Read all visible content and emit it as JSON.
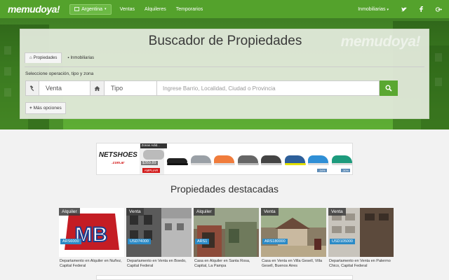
{
  "header": {
    "logo": "memudoya!",
    "country": "Argentina",
    "nav": [
      "Ventas",
      "Alquileres",
      "Temporarios"
    ],
    "inmobiliarias": "Inmobiliarias",
    "social": [
      "twitter-icon",
      "facebook-icon",
      "google-plus-icon"
    ]
  },
  "search": {
    "title": "Buscador de Propiedades",
    "watermark": "memudoya!",
    "tabs": [
      "Propiedades",
      "Inmobiliarias"
    ],
    "operation_label": "Seleccione operación, tipo y zona",
    "operation_value": "Venta",
    "type_value": "Tipo",
    "location_placeholder": "Ingrese Barrio, Localidad, Ciudad o Provincia",
    "more_options": "Más opciones"
  },
  "ad": {
    "brand": "NETSHOES",
    "brand_sub": ".com.ar",
    "promo_tag": "Zonas Adid...",
    "promo_price": "$359.89",
    "promo_cta": "AMPLIAR",
    "shoe_discounts": [
      "",
      "",
      "",
      "",
      "",
      "",
      "-34%",
      "-30%"
    ]
  },
  "featured": {
    "title": "Propiedades destacadas",
    "items": [
      {
        "operation": "Alquiler",
        "price": "ARS6000",
        "caption": "Departamento en Alquiler en Nuñez, Capital Federal"
      },
      {
        "operation": "Venta",
        "price": "USD74000",
        "caption": "Departamento en Venta en Boedo, Capital Federal"
      },
      {
        "operation": "Alquiler",
        "price": "ARS1",
        "caption": "Casa en Alquiler en Santa Rosa, Capital, La Pampa"
      },
      {
        "operation": "Venta",
        "price": "ARS180000",
        "caption": "Casa en Venta en Villa Gesell, Villa Gesell, Buenos Aires"
      },
      {
        "operation": "Venta",
        "price": "USD105000",
        "caption": "Departamento en Venta en Palermo Chico, Capital Federal"
      }
    ]
  },
  "colors": {
    "brand_green": "#54a22c",
    "price_blue": "#2b8ac6",
    "ad_red": "#d31a1a"
  }
}
